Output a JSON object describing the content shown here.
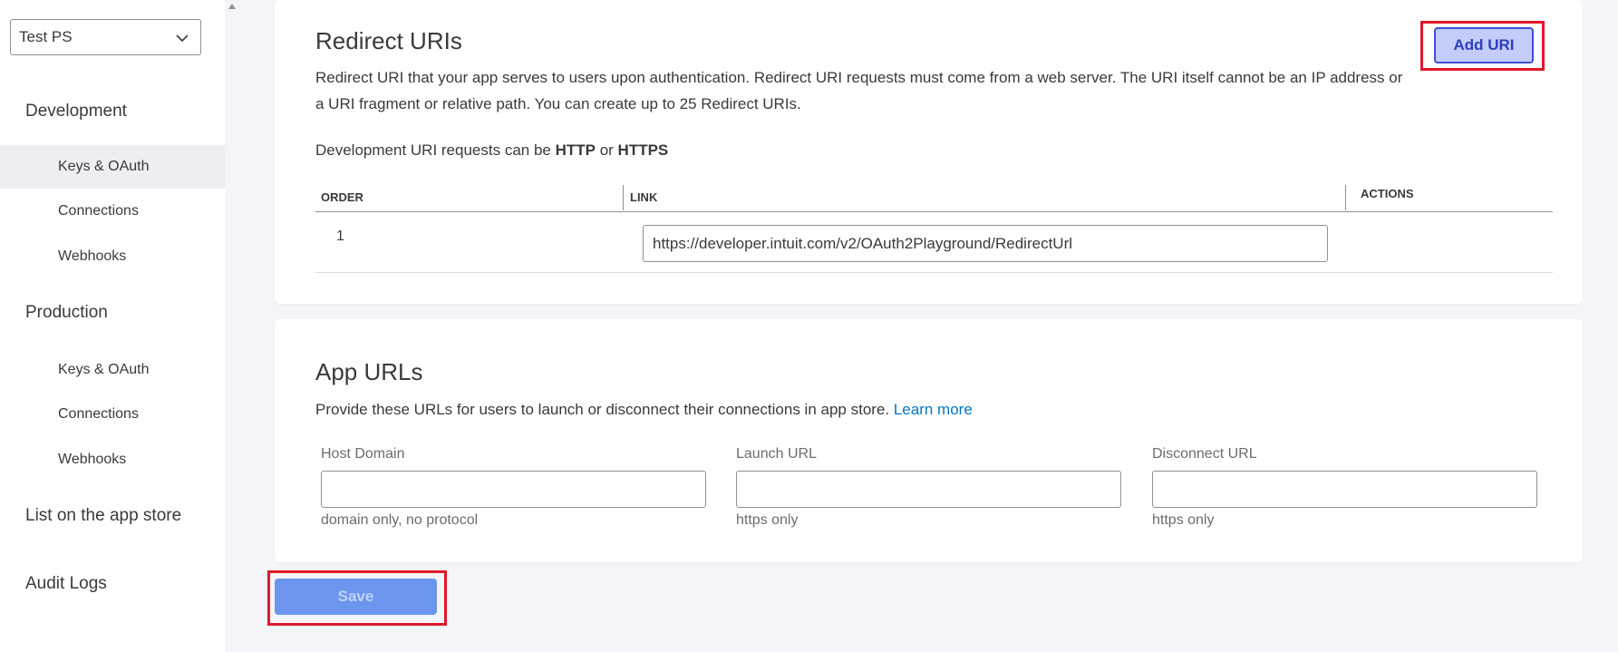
{
  "sidebar": {
    "app_select": "Test PS",
    "development": {
      "label": "Development",
      "items": [
        {
          "label": "Keys & OAuth"
        },
        {
          "label": "Connections"
        },
        {
          "label": "Webhooks"
        }
      ]
    },
    "production": {
      "label": "Production",
      "items": [
        {
          "label": "Keys & OAuth"
        },
        {
          "label": "Connections"
        },
        {
          "label": "Webhooks"
        }
      ]
    },
    "list_app_store": "List on the app store",
    "audit_logs": "Audit Logs"
  },
  "redirect": {
    "title": "Redirect URIs",
    "description": "Redirect URI that your app serves to users upon authentication. Redirect URI requests must come from a web server. The URI itself cannot be an IP address or a URI fragment or relative path. You can create up to 25 Redirect URIs.",
    "dev_prefix": "Development URI requests can be ",
    "dev_http": "HTTP",
    "dev_or": " or ",
    "dev_https": "HTTPS",
    "add_button": "Add URI",
    "columns": {
      "order": "ORDER",
      "link": "LINK",
      "actions": "ACTIONS"
    },
    "rows": [
      {
        "order": "1",
        "link": "https://developer.intuit.com/v2/OAuth2Playground/RedirectUrl"
      }
    ]
  },
  "app_urls": {
    "title": "App URLs",
    "description": "Provide these URLs for users to launch or disconnect their connections in app store. ",
    "learn_more": "Learn more",
    "fields": [
      {
        "label": "Host Domain",
        "value": "",
        "hint": "domain only, no protocol"
      },
      {
        "label": "Launch URL",
        "value": "",
        "hint": "https only"
      },
      {
        "label": "Disconnect URL",
        "value": "",
        "hint": "https only"
      }
    ]
  },
  "save_button": "Save",
  "colors": {
    "primary": "#0077c5",
    "save_bg": "#6c96ee",
    "add_bg": "#c4ccf9",
    "highlight": "#e0192b"
  }
}
